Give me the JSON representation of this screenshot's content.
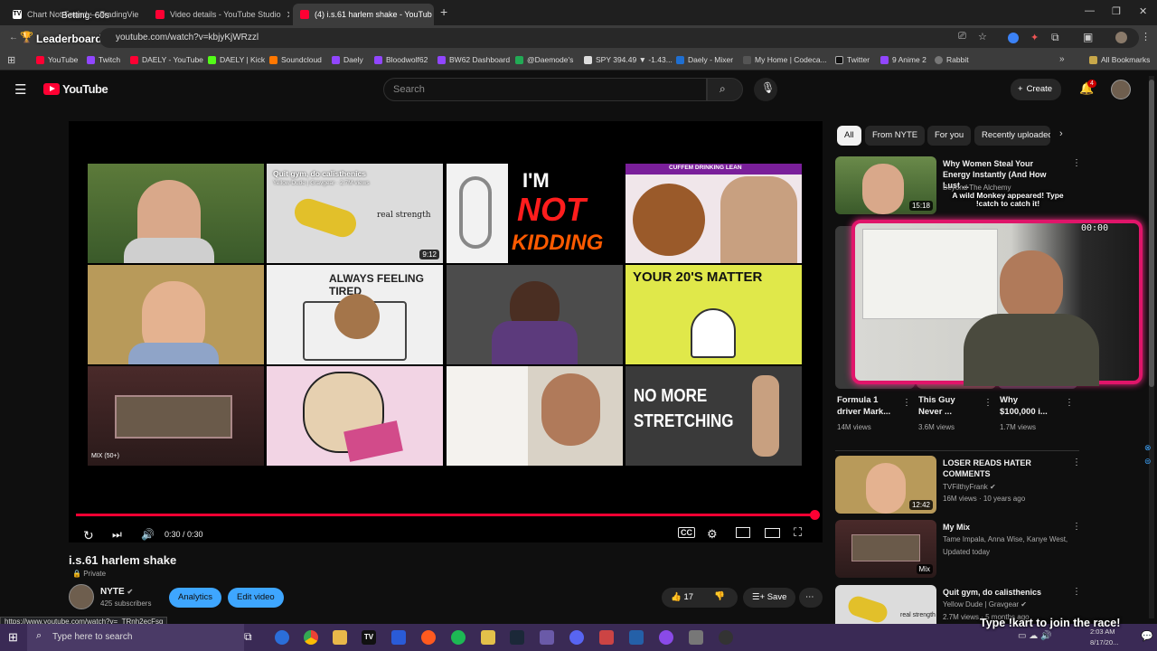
{
  "browser": {
    "tabs": [
      {
        "label": "Chart Not Found — TradingVie",
        "fav": "#ffffff"
      },
      {
        "label": "Video details - YouTube Studio",
        "fav": "#ff0033"
      },
      {
        "label": "(4) i.s.61 harlem shake - YouTub",
        "fav": "#ff0033"
      }
    ],
    "overlay_betting": "Betting: 60s",
    "overlay_leaderboard": "Leaderboard",
    "url": "youtube.com/watch?v=kbjyKjWRzzl",
    "bookmarks": [
      {
        "label": "YouTube",
        "color": "#ff0033"
      },
      {
        "label": "Twitch",
        "color": "#9146ff"
      },
      {
        "label": "DAELY - YouTube",
        "color": "#ff0033"
      },
      {
        "label": "DAELY | Kick",
        "color": "#53fc18"
      },
      {
        "label": "Soundcloud",
        "color": "#ff7700"
      },
      {
        "label": "Daely",
        "color": "#9146ff"
      },
      {
        "label": "Bloodwolf62",
        "color": "#9146ff"
      },
      {
        "label": "BW62 Dashboard",
        "color": "#9146ff"
      },
      {
        "label": "@Daemode's",
        "color": "#22aa55"
      },
      {
        "label": "SPY 394.49 ▼ -1.43...",
        "color": "#dddddd"
      },
      {
        "label": "Daely - Mixer",
        "color": "#1f6fd1"
      },
      {
        "label": "My Home | Codeca...",
        "color": "#555555"
      },
      {
        "label": "Twitter",
        "color": "#111111"
      },
      {
        "label": "9 Anime 2",
        "color": "#9146ff"
      },
      {
        "label": "Rabbit",
        "color": "#777777"
      }
    ],
    "all_bookmarks": "All Bookmarks"
  },
  "youtube": {
    "logo": "YouTube",
    "search_placeholder": "Search",
    "create": "Create",
    "notif_count": "4"
  },
  "player": {
    "tile_texts": {
      "calisthenics_title": "Quit gym, do calisthenics",
      "calisthenics_meta": "Yellow Dude | Gravgear · 2.7M views",
      "real_strength": "real strength",
      "duration": "9:12",
      "im": "I'M",
      "not": "NOT",
      "kidding": "KIDDING",
      "cuffem": "CUFFEM DRINKING LEAN",
      "tired": "ALWAYS FEELING TIRED",
      "twenties": "YOUR 20'S MATTER",
      "no_more": "NO MORE",
      "stretching": "STRETCHING",
      "mix_label": "MIX (50+)"
    },
    "time": "0:30 / 0:30",
    "progress": 1.0
  },
  "video": {
    "title": "i.s.61 harlem shake",
    "privacy": "Private",
    "channel": "NYTE",
    "subscribers": "425 subscribers",
    "analytics": "Analytics",
    "edit_video": "Edit video",
    "likes": "17",
    "save": "Save"
  },
  "chips": [
    "All",
    "From NYTE",
    "For you",
    "Recently uploaded"
  ],
  "sidebar": {
    "top": {
      "title": "Why Women Steal Your Energy Instantly (And How Lust ...",
      "channel": "Beyond The Alchemy",
      "duration": "15:18"
    },
    "overlay_monkey": "A wild Monkey appeared! Type !catch to catch it!",
    "cam_timer": "00:00",
    "shorts": [
      {
        "title": "Formula 1 driver Mark...",
        "views": "14M views"
      },
      {
        "title": "This Guy Never ...",
        "views": "3.6M views"
      },
      {
        "title": "Why $100,000 i...",
        "views": "1.7M views"
      }
    ],
    "items": [
      {
        "title": "LOSER READS HATER COMMENTS",
        "channel": "TVFilthyFrank",
        "meta": "16M views · 10 years ago",
        "duration": "12:42"
      },
      {
        "title": "My Mix",
        "channel": "Tame Impala, Anna Wise, Kanye West, an...",
        "meta": "Updated today",
        "duration": "Mix"
      },
      {
        "title": "Quit gym, do calisthenics",
        "channel": "Yellow Dude | Gravgear",
        "meta": "2.7M views · 5 months ago",
        "duration": ""
      }
    ]
  },
  "status_url": "https://www.youtube.com/watch?v=_TRnh2ecFsg",
  "race_overlay": "Type !kart to join the race!",
  "taskbar": {
    "search_placeholder": "Type here to search",
    "time": "2:03 AM",
    "date": "8/17/20..."
  }
}
